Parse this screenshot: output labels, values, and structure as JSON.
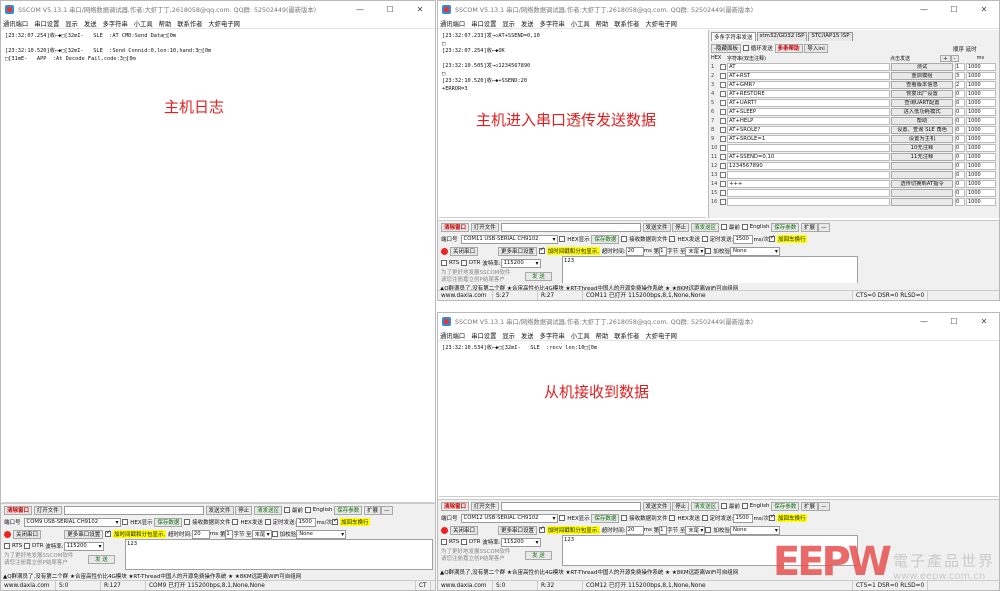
{
  "windows": [
    {
      "title": "SSCOM V5.13.1 串口/网络数据调试器,作者:大虾丁丁,2618058@qq.com. QQ群: 52502449(最新版本)",
      "menu": [
        "通讯端口",
        "串口设置",
        "显示",
        "发送",
        "多字符串",
        "小工具",
        "帮助",
        "联系作者",
        "大虾电子网"
      ],
      "log": "[23:32:07.254]收←◆□[32mI-   SLE  :AT CMD:Send Data□[0m\n\n[23:32:10.520]收←◆□[32mI-   SLE  :Send Connid:0,len:10,hand:3□[0m\n□[31mE-   APP  :At Decode Fail,code:3□[0m",
      "overlay": "主机日志",
      "port_label": "端口号",
      "port": "COM9 USB-SERIAL CH9102",
      "hex_display": "HEX显示",
      "save_data": "保存数据",
      "recv_to_file": "接收数据到文件",
      "hex_send": "HEX发送",
      "timed_send": "定时发送:",
      "interval": "1500",
      "interval_unit": "ms/次",
      "append_newline": "加回车换行",
      "close_port": "关闭串口",
      "more_settings": "更多串口设置",
      "timestamp": "加时间戳和分包显示,",
      "timeout_label": "超时时间:",
      "timeout": "20",
      "timeout_unit": "ms",
      "nth_label": "第",
      "nth": "1",
      "byte_label": "字节",
      "to_label": "至",
      "end": "末尾",
      "checksum_label": "加校验",
      "checksum": "None",
      "rts": "RTS",
      "dtr": "DTR",
      "baud_label": "波特率:",
      "baud": "115200",
      "send_text": "123",
      "send": "发 送",
      "ad1": "为了更好地发展SSCOM软件",
      "ad2": "请您注册嘉立创P结尾客户",
      "promo": "▲Q群满员了,没有第二个群 ★合宙高性价比4G模块 ★RT-Thread中国人的开源免费操作系统 ★ ★8KM远距离WiFi可自组网",
      "clear_window": "清除窗口",
      "open_file": "打开文件",
      "send_file": "发送文件",
      "stop": "停止",
      "clear_send": "清发送区",
      "topmost": "最前",
      "english": "English",
      "save_params": "保存参数",
      "expand": "扩展",
      "expand2": "—",
      "status": [
        "www.daxia.com",
        "S:0",
        "R:127",
        "COM9 已打开  115200bps,8,1,None,None",
        "CT"
      ]
    },
    {
      "title": "SSCOM V5.13.1 串口/网络数据调试器,作者:大虾丁丁,2618058@qq.com. QQ群: 52502449(最新版本)",
      "menu": [
        "通讯端口",
        "串口设置",
        "显示",
        "发送",
        "多字符串",
        "小工具",
        "帮助",
        "联系作者",
        "大虾电子网"
      ],
      "log": "[23:32:07.233]发→◇AT+SSEND=0,10\n□\n[23:32:07.254]收←◆OK\n\n[23:32:10.505]发→◇1234567890\n□\n[23:32:10.520]收←◆+SSEND:20\n+ERROR=3",
      "overlay": "主机进入串口透传发送数据",
      "port_label": "端口号",
      "port": "COM11 USB-SERIAL CH9102",
      "hex_display": "HEX显示",
      "save_data": "保存数据",
      "recv_to_file": "接收数据到文件",
      "hex_send": "HEX发送",
      "timed_send": "定时发送:",
      "interval": "1500",
      "interval_unit": "ms/次",
      "append_newline": "加回车换行",
      "close_port": "关闭串口",
      "more_settings": "更多串口设置",
      "timestamp": "加时间戳和分包显示,",
      "timeout_label": "超时时间:",
      "timeout": "20",
      "timeout_unit": "ms",
      "nth_label": "第",
      "nth": "1",
      "byte_label": "字节",
      "to_label": "至",
      "end": "末尾",
      "checksum_label": "加校验",
      "checksum": "None",
      "rts": "RTS",
      "dtr": "DTR",
      "baud_label": "波特率:",
      "baud": "115200",
      "send_text": "123",
      "send": "发 送",
      "ad1": "为了更好地发展SSCOM软件",
      "ad2": "请您注册嘉立创P结尾客户",
      "promo": "▲Q群满员了,没有第二个群 ★合宙高性价比4G模块 ★RT-Thread中国人的开源免费操作系统 ★ ★8KM远距离WiFi可自组网",
      "clear_window": "清除窗口",
      "open_file": "打开文件",
      "send_file": "发送文件",
      "stop": "停止",
      "clear_send": "清发送区",
      "topmost": "最前",
      "english": "English",
      "save_params": "保存参数",
      "expand": "扩展",
      "expand2": "—",
      "status": [
        "www.daxia.com",
        "S:27",
        "R:27",
        "COM11 已打开  115200bps,8,1,None,None",
        "CTS=0 DSR=0 RLSD=0"
      ]
    },
    {
      "title": "SSCOM V5.13.1 串口/网络数据调试器,作者:大虾丁丁,2618058@qq.com. QQ群: 52502449(最新版本)",
      "menu": [
        "通讯端口",
        "串口设置",
        "显示",
        "发送",
        "多字符串",
        "小工具",
        "帮助",
        "联系作者",
        "大虾电子网"
      ],
      "log": "[23:32:10.534]收←◆□[32mI-   SLE  :recv len:10□[0m",
      "overlay": "从机接收到数据",
      "port_label": "端口号",
      "port": "COM12 USB-SERIAL CH9102",
      "hex_display": "HEX显示",
      "save_data": "保存数据",
      "recv_to_file": "接收数据到文件",
      "hex_send": "HEX发送",
      "timed_send": "定时发送:",
      "interval": "1500",
      "interval_unit": "ms/次",
      "append_newline": "加回车换行",
      "close_port": "关闭串口",
      "more_settings": "更多串口设置",
      "timestamp": "加时间戳和分包显示,",
      "timeout_label": "超时时间:",
      "timeout": "20",
      "timeout_unit": "ms",
      "nth_label": "第",
      "nth": "1",
      "byte_label": "字节",
      "to_label": "至",
      "end": "末尾",
      "checksum_label": "加校验",
      "checksum": "None",
      "rts": "RTS",
      "dtr": "DTR",
      "baud_label": "波特率:",
      "baud": "115200",
      "send_text": "123",
      "send": "发 送",
      "ad1": "为了更好地发展SSCOM软件",
      "ad2": "请您注册嘉立创P结尾客户",
      "promo": "▲Q群满员了,没有第二个群 ★合宙高性价比4G模块 ★RT-Thread中国人的开源免费操作系统 ★ ★8KM远距离WiFi可自组网",
      "clear_window": "清除窗口",
      "open_file": "打开文件",
      "send_file": "发送文件",
      "stop": "停止",
      "clear_send": "清发送区",
      "topmost": "最前",
      "english": "English",
      "save_params": "保存参数",
      "expand": "扩展",
      "expand2": "—",
      "status": [
        "www.daxia.com",
        "S:0",
        "R:32",
        "COM12 已打开  115200bps,8,1,None,None",
        "CTS=1 DSR=0 RLSD=0"
      ]
    }
  ],
  "multi": {
    "tabs": [
      "多条字符串发送",
      "stm32/GD32 ISP",
      "STC/IAP15 ISP"
    ],
    "hide_panel": "-隐藏面板",
    "loop_send": "循环发送",
    "multi_help": "多条帮助",
    "import_ini": "导入ini",
    "order_label": "顺序",
    "delay_label": "延时",
    "hex_label": "HEX",
    "string_label": "字符串(双击注释)",
    "click_send": "点击发送",
    "plus": "+",
    "minus": "-",
    "ms": "ms",
    "rows": [
      {
        "text": "AT",
        "btn": "测试",
        "order": "1",
        "delay": "1000"
      },
      {
        "text": "AT+RST",
        "btn": "重启模组",
        "order": "3",
        "delay": "1000"
      },
      {
        "text": "AT+GMR?",
        "btn": "查看版本信息",
        "order": "2",
        "delay": "1000"
      },
      {
        "text": "AT+RESTORE",
        "btn": "恢复出厂设置",
        "order": "0",
        "delay": "1000"
      },
      {
        "text": "AT+UART?",
        "btn": "查询UART配置",
        "order": "0",
        "delay": "1000"
      },
      {
        "text": "AT+SLEEP",
        "btn": "进入低功耗模式",
        "order": "0",
        "delay": "1000"
      },
      {
        "text": "AT+HELP",
        "btn": "帮助",
        "order": "0",
        "delay": "1000"
      },
      {
        "text": "AT+SROLE?",
        "btn": "设置、查询 SLE 角色",
        "order": "0",
        "delay": "1000"
      },
      {
        "text": "AT+SROLE=1",
        "btn": "设置为主机",
        "order": "0",
        "delay": "1000"
      },
      {
        "text": "",
        "btn": "10无注释",
        "order": "0",
        "delay": "1000"
      },
      {
        "text": "AT+SSEND=0,10",
        "btn": "11无注释",
        "order": "0",
        "delay": "1000"
      },
      {
        "text": "1234567890",
        "btn": "",
        "order": "0",
        "delay": "1000"
      },
      {
        "text": "",
        "btn": "",
        "order": "0",
        "delay": "1000"
      },
      {
        "text": "+++",
        "btn": "透传切换到AT指令",
        "order": "0",
        "delay": "1000"
      },
      {
        "text": "",
        "btn": "",
        "order": "0",
        "delay": "1000"
      },
      {
        "text": "",
        "btn": "",
        "order": "0",
        "delay": "1000"
      }
    ]
  },
  "watermark": {
    "logo": "EEPW",
    "cn": "電子產品世界",
    "url": "www.eepw.com.cn"
  },
  "colors": {
    "overlay": "#e02020",
    "accent_red": "#cc0000",
    "green": "#107010",
    "highlight": "#ffff00"
  }
}
